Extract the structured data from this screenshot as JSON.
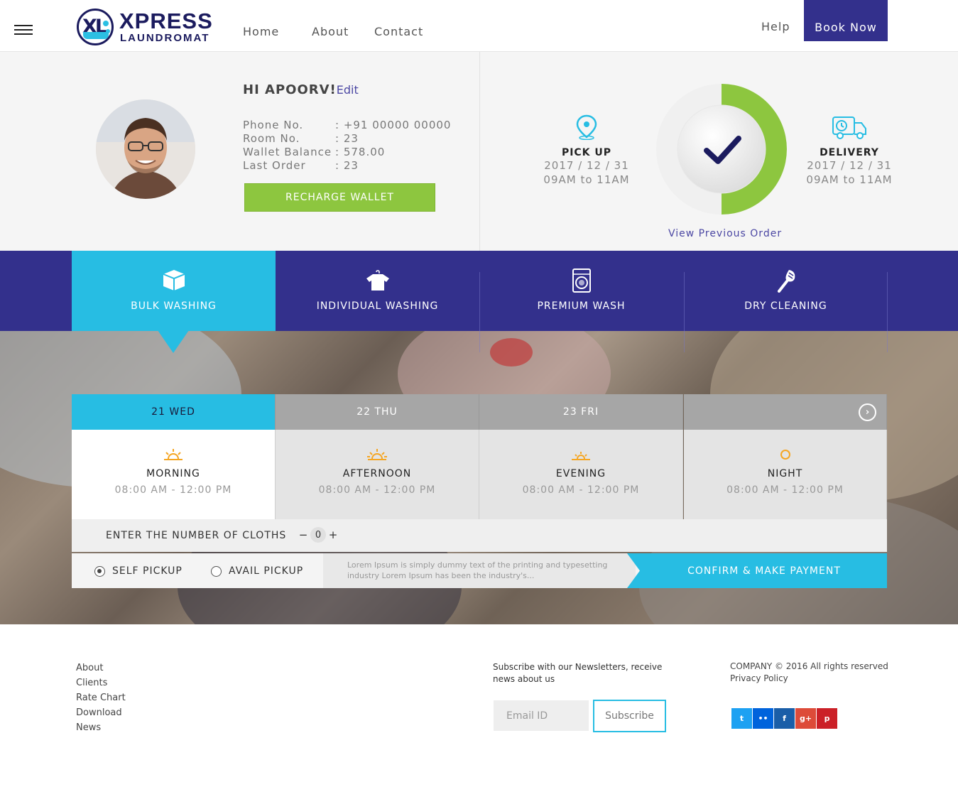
{
  "header": {
    "logo_main": "XPRESS",
    "logo_sub": "LAUNDROMAT",
    "logo_mark": "XL",
    "nav": [
      "Home",
      "About",
      "Contact"
    ],
    "help": "Help",
    "book_now": "Book Now"
  },
  "profile": {
    "greeting": "HI APOORV!",
    "edit": "Edit",
    "rows": [
      {
        "label": "Phone No.",
        "value": ": +91 00000 00000"
      },
      {
        "label": "Room No.",
        "value": ": 23"
      },
      {
        "label": "Wallet Balance",
        "value": ": 578.00"
      },
      {
        "label": "Last Order",
        "value": ": 23"
      }
    ],
    "recharge": "RECHARGE WALLET"
  },
  "order": {
    "pickup": {
      "label": "PICK UP",
      "date": "2017 / 12 / 31",
      "time": "09AM to 11AM"
    },
    "delivery": {
      "label": "DELIVERY",
      "date": "2017 / 12 / 31",
      "time": "09AM to 11AM"
    },
    "view_previous": "View Previous Order",
    "progress": 0.5
  },
  "services": [
    "BULK WASHING",
    "INDIVIDUAL WASHING",
    "PREMIUM WASH",
    "DRY CLEANING"
  ],
  "days": [
    "21 WED",
    "22 THU",
    "23 FRI"
  ],
  "slots": [
    {
      "name": "MORNING",
      "time": "08:00 AM - 12:00 PM"
    },
    {
      "name": "AFTERNOON",
      "time": "08:00 AM - 12:00 PM"
    },
    {
      "name": "EVENING",
      "time": "08:00 AM - 12:00 PM"
    },
    {
      "name": "NIGHT",
      "time": "08:00 AM - 12:00 PM"
    }
  ],
  "cloths": {
    "label": "ENTER THE NUMBER OF CLOTHS",
    "value": "0",
    "minus": "−",
    "plus": "+"
  },
  "pickup_options": [
    "SELF PICKUP",
    "AVAIL PICKUP"
  ],
  "lorem": "Lorem Ipsum is simply dummy text of the printing and typesetting industry Lorem Ipsum has been the industry's...",
  "confirm": "CONFIRM & MAKE PAYMENT",
  "footer": {
    "links": [
      "About",
      "Clients",
      "Rate Chart",
      "Download",
      "News"
    ],
    "newsletter": "Subscribe with our Newsletters, receive news about us",
    "email_placeholder": "Email ID",
    "subscribe": "Subscribe",
    "copyright": "COMPANY © 2016 All rights reserved",
    "privacy": "Privacy Policy",
    "social": [
      {
        "icon": "twitter-icon",
        "glyph": "t",
        "color": "#1da1f2"
      },
      {
        "icon": "flickr-icon",
        "glyph": "••",
        "color": "#0063dc"
      },
      {
        "icon": "facebook-icon",
        "glyph": "f",
        "color": "#1a5ea8"
      },
      {
        "icon": "google-plus-icon",
        "glyph": "g+",
        "color": "#dd4b39"
      },
      {
        "icon": "pinterest-icon",
        "glyph": "p",
        "color": "#cb2027"
      }
    ]
  },
  "colors": {
    "primary": "#33308c",
    "accent": "#27bde3",
    "green": "#8dc63f"
  }
}
